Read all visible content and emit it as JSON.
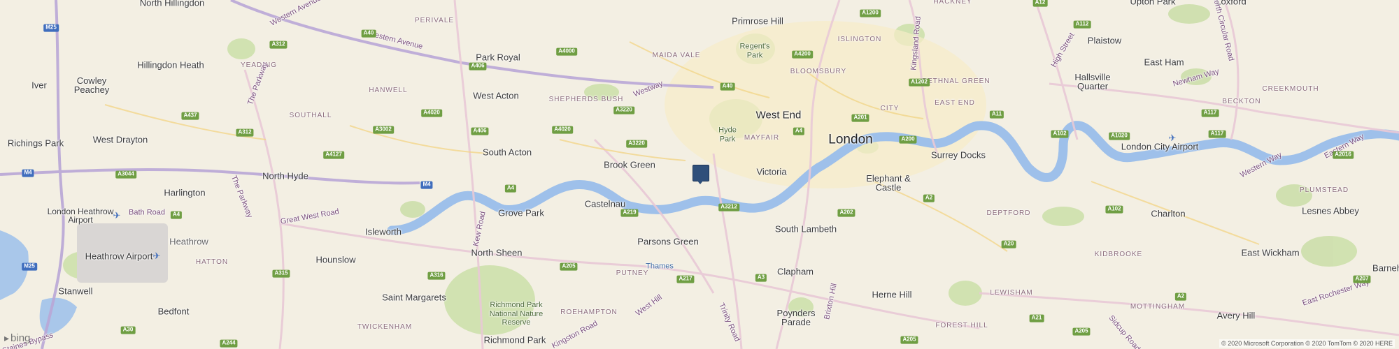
{
  "logo": {
    "glyph": "▸",
    "text": "bing"
  },
  "copyright": "© 2020 Microsoft Corporation © 2020 TomTom © 2020 HERE",
  "pin": {
    "label": ""
  },
  "labels": {
    "london": "London",
    "westend": "West End",
    "victoria": "Victoria",
    "elephant": "Elephant & Castle",
    "southlambeth": "South Lambeth",
    "clapham": "Clapham",
    "hernehill": "Herne Hill",
    "poynders": "Poynders Parade",
    "surreydocks": "Surrey Docks",
    "charlton": "Charlton",
    "lesnes": "Lesnes Abbey",
    "eastwickham": "East Wickham",
    "averyhill": "Avery Hill",
    "barnehurst": "Barneh",
    "eastham": "East Ham",
    "plaistow": "Plaistow",
    "uptonpark": "Upton Park",
    "loxford": "Loxford",
    "hallsville": "Hallsville Quarter",
    "primrose": "Primrose Hill",
    "parkroyal": "Park Royal",
    "westacton": "West Acton",
    "southacton": "South Acton",
    "brookgreen": "Brook Green",
    "castelnau": "Castelnau",
    "grovepark": "Grove Park",
    "parsonsgreen": "Parsons Green",
    "northsheen": "North Sheen",
    "isleworth": "Isleworth",
    "hounslow": "Hounslow",
    "saintmargarets": "Saint Margarets",
    "bedfont": "Bedfont",
    "stanwell": "Stanwell",
    "northhyde": "North Hyde",
    "harlington": "Harlington",
    "westdrayton": "West Drayton",
    "richingspark": "Richings Park",
    "iver": "Iver",
    "cowley": "Cowley Peachey",
    "hillingdonheath": "Hillingdon Heath",
    "northhillingdon": "North Hillingdon",
    "heathrowairport": "Heathrow Airport",
    "heathrowterm": "Heathrow",
    "lhr": "London Heathrow Airport",
    "lcy": "London City Airport",
    "richmondpark": "Richmond Park",
    "thames": "Thames"
  },
  "districts": {
    "perivale": "PERIVALE",
    "yeading": "YEADING",
    "hanwell": "HANWELL",
    "southall": "SOUTHALL",
    "shepherds": "SHEPHERDS BUSH",
    "maidavale": "MAIDA VALE",
    "bloomsbury": "BLOOMSBURY",
    "islington": "ISLINGTON",
    "hackney": "HACKNEY",
    "bethnal": "BETHNAL GREEN",
    "city": "CITY",
    "eastend": "EAST END",
    "mayfair": "MAYFAIR",
    "putney": "PUTNEY",
    "roehampton": "ROEHAMPTON",
    "twickenham": "TWICKENHAM",
    "hatton": "HATTON",
    "deptford": "DEPTFORD",
    "lewisham": "LEWISHAM",
    "kidbrooke": "KIDBROOKE",
    "foresthill": "FOREST HILL",
    "mottingham": "MOTTINGHAM",
    "plumstead": "PLUMSTEAD",
    "beckton": "BECKTON",
    "creekmouth": "CREEKMOUTH"
  },
  "parks": {
    "regents": "Regent's Park",
    "hyde": "Hyde Park",
    "richmondnnr": "Richmond Park National Nature Reserve"
  },
  "roads": {
    "westernave": "Western Avenue",
    "westway": "Westway",
    "greatwest": "Great West Road",
    "bathroad": "Bath Road",
    "theparkway": "The Parkway",
    "kewroad": "Kew Road",
    "westhill": "West Hill",
    "kingstonroad": "Kingston Road",
    "trinityroad": "Trinity Road",
    "brixtonhill": "Brixton Hill",
    "kingslandroad": "Kingsland Road",
    "highstreet": "High Street",
    "newhamway": "Newham Way",
    "northcircular": "North Circular Road",
    "easternway": "Eastern Way",
    "westernway": "Western Way",
    "eastrochester": "East Rochester Way",
    "sidcuproad": "Sidcup Road",
    "staines": "Staines Bypass",
    "westernave2": "Western Avenue"
  },
  "badges": {
    "m25a": "M25",
    "m25b": "M25",
    "m4a": "M4",
    "m4b": "M4",
    "a40a": "A40",
    "a40b": "A40",
    "a312a": "A312",
    "a312b": "A312",
    "a437": "A437",
    "a3002": "A3002",
    "a4127": "A4127",
    "a4020a": "A4020",
    "a4020b": "A4020",
    "a406a": "A406",
    "a406b": "A406",
    "a4000": "A4000",
    "a3220a": "A3220",
    "a3220b": "A3220",
    "a4200": "A4200",
    "a1200": "A1200",
    "a12": "A12",
    "a112": "A112",
    "a1202": "A1202",
    "a201": "A201",
    "a4": "A4",
    "a200": "A200",
    "a11": "A11",
    "a102a": "A102",
    "a102b": "A102",
    "a1020": "A1020",
    "a117": "A117",
    "a2016": "A2016",
    "a3044": "A3044",
    "a4b": "A4",
    "a4c": "A4",
    "a219": "A219",
    "a3212": "A3212",
    "a202": "A202",
    "a2": "A2",
    "a20": "A20",
    "a205a": "A205",
    "a205b": "A205",
    "a205c": "A205",
    "a217": "A217",
    "a3": "A3",
    "a316": "A316",
    "a315": "A315",
    "a30": "A30",
    "a244": "A244",
    "a21": "A21",
    "a2b": "A2",
    "a207": "A207",
    "a1117": "A117"
  }
}
